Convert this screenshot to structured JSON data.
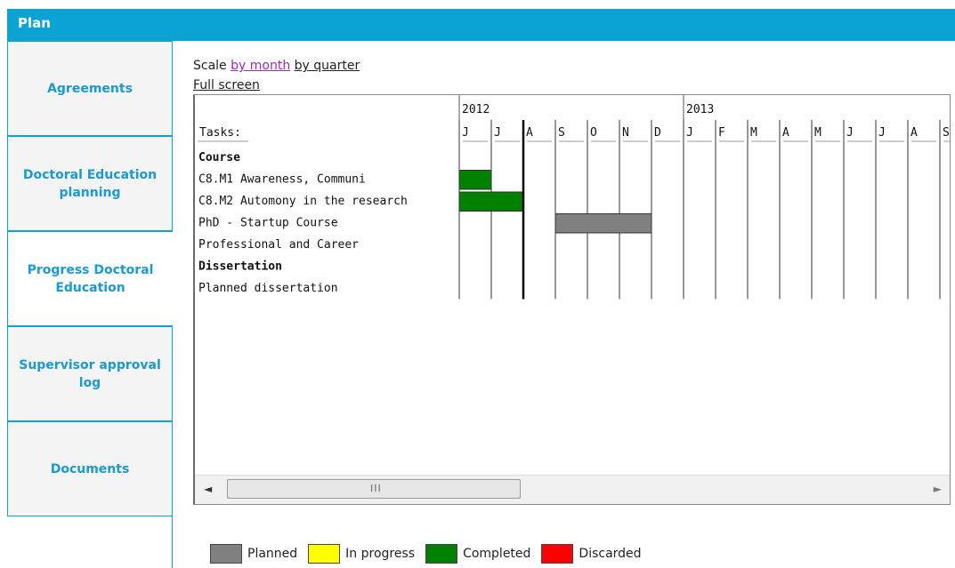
{
  "header": {
    "title": "Plan"
  },
  "sidebar": {
    "tabs": [
      {
        "label": "Agreements"
      },
      {
        "label": "Doctoral Education planning"
      },
      {
        "label": "Progress Doctoral Education"
      },
      {
        "label": "Supervisor approval log"
      },
      {
        "label": "Documents"
      }
    ],
    "active_index": 2
  },
  "toolbar": {
    "scale_label": "Scale",
    "by_month": "by month",
    "by_quarter": "by quarter",
    "full_screen": "Full screen"
  },
  "gantt": {
    "tasks_header": "Tasks:",
    "years": [
      {
        "label": "2012",
        "start_month_index": 0
      },
      {
        "label": "2013",
        "start_month_index": 7
      }
    ],
    "months": [
      "J",
      "J",
      "A",
      "S",
      "O",
      "N",
      "D",
      "J",
      "F",
      "M",
      "A",
      "M",
      "J",
      "J",
      "A",
      "S"
    ],
    "today_marker_month_index": 2,
    "rows": [
      {
        "label": "Course",
        "bold": true
      },
      {
        "label": " C8.M1 Awareness, Communi",
        "bold": false,
        "bar": {
          "start": 0,
          "end": 1,
          "status": "Completed"
        }
      },
      {
        "label": "C8.M2 Automony in the research",
        "bold": false,
        "bar": {
          "start": 0,
          "end": 2,
          "status": "Completed"
        }
      },
      {
        "label": " PhD - Startup Course",
        "bold": false,
        "bar": {
          "start": 3,
          "end": 6,
          "status": "Planned"
        }
      },
      {
        "label": "Professional  and Career",
        "bold": false
      },
      {
        "label": "Dissertation",
        "bold": true
      },
      {
        "label": "Planned dissertation",
        "bold": false
      }
    ]
  },
  "scrollbar": {
    "left_arrow": "◄",
    "right_arrow": "►",
    "grip": "III"
  },
  "legend": [
    {
      "label": "Planned",
      "color": "#808080"
    },
    {
      "label": "In progress",
      "color": "#ffff00"
    },
    {
      "label": "Completed",
      "color": "#008000"
    },
    {
      "label": "Discarded",
      "color": "#ff0000"
    }
  ],
  "colors": {
    "accent": "#0aa3d4",
    "tab_text": "#1a9ad0"
  }
}
